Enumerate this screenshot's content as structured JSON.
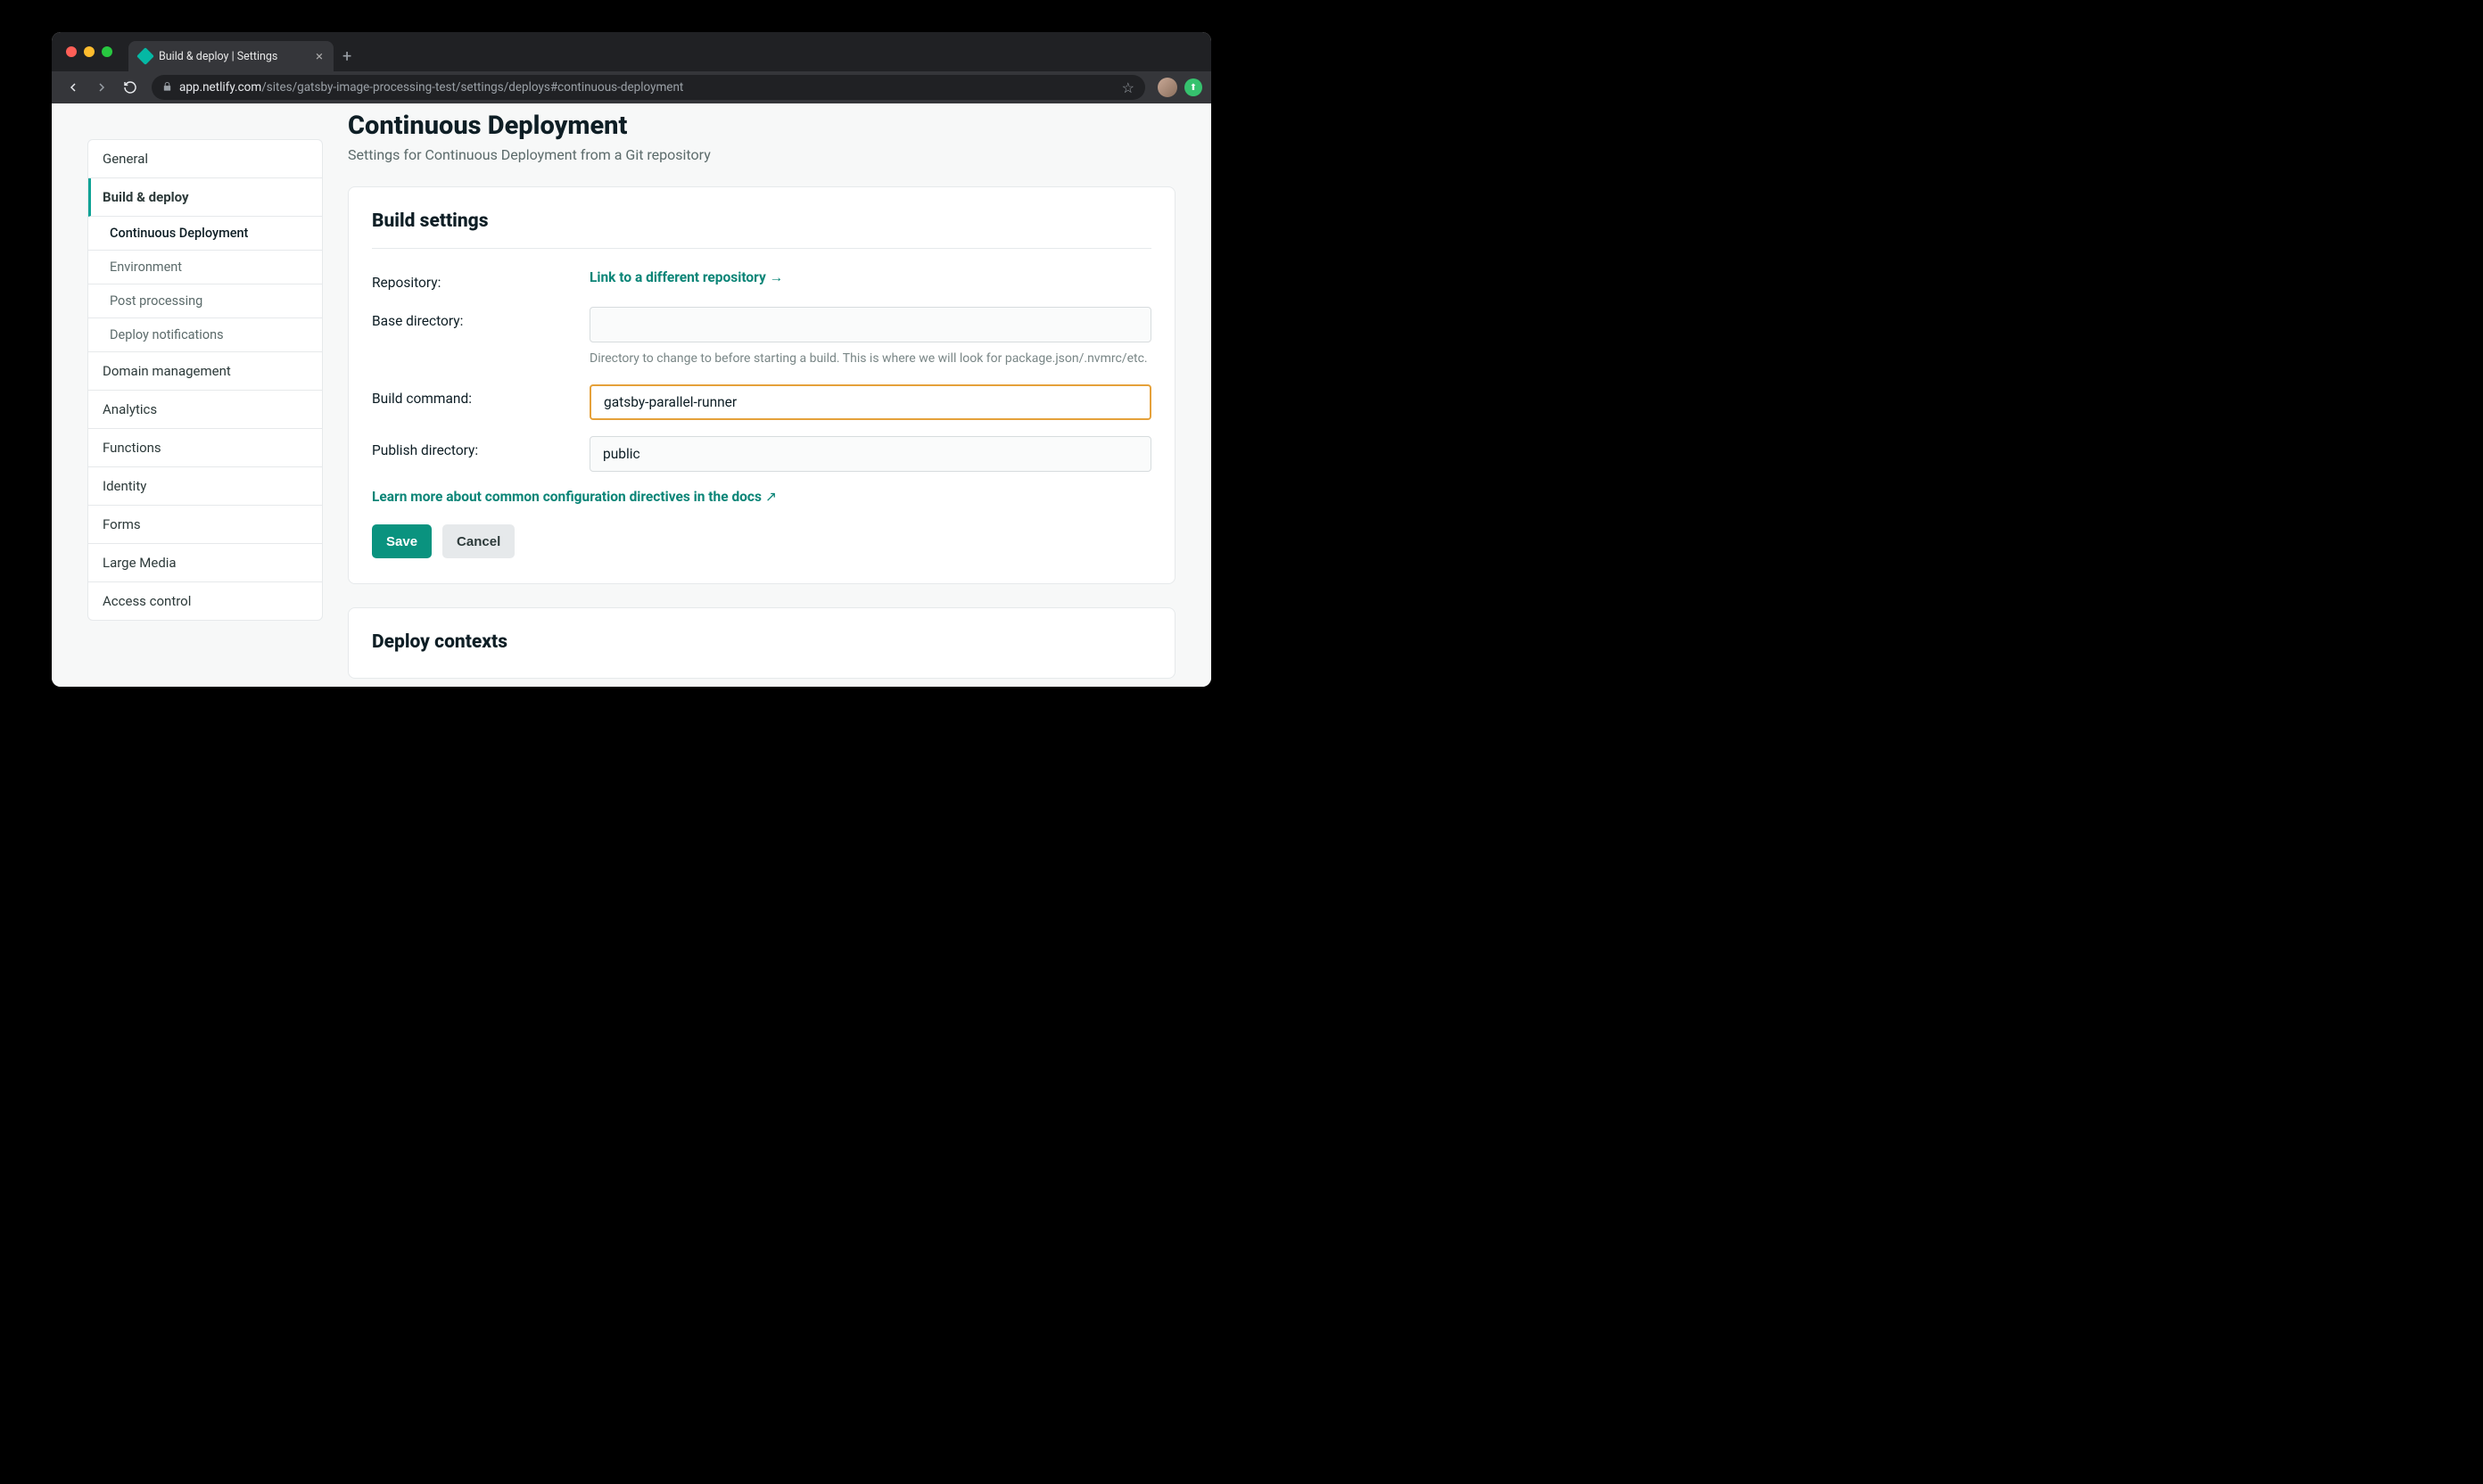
{
  "browser": {
    "tab_title": "Build & deploy | Settings",
    "url_host": "app.netlify.com",
    "url_path": "/sites/gatsby-image-processing-test/settings/deploys#continuous-deployment"
  },
  "sidebar": {
    "items": [
      {
        "label": "General"
      },
      {
        "label": "Build & deploy"
      },
      {
        "label": "Domain management"
      },
      {
        "label": "Analytics"
      },
      {
        "label": "Functions"
      },
      {
        "label": "Identity"
      },
      {
        "label": "Forms"
      },
      {
        "label": "Large Media"
      },
      {
        "label": "Access control"
      }
    ],
    "subs": [
      {
        "label": "Continuous Deployment"
      },
      {
        "label": "Environment"
      },
      {
        "label": "Post processing"
      },
      {
        "label": "Deploy notifications"
      }
    ]
  },
  "page": {
    "title": "Continuous Deployment",
    "subtitle": "Settings for Continuous Deployment from a Git repository"
  },
  "build_settings": {
    "heading": "Build settings",
    "repo_label": "Repository:",
    "repo_link": "Link to a different repository",
    "base_label": "Base directory:",
    "base_value": "",
    "base_help": "Directory to change to before starting a build. This is where we will look for package.json/.nvmrc/etc.",
    "cmd_label": "Build command:",
    "cmd_value": "gatsby-parallel-runner",
    "pub_label": "Publish directory:",
    "pub_value": "public",
    "learn_more": "Learn more about common configuration directives in the docs",
    "save": "Save",
    "cancel": "Cancel"
  },
  "deploy_contexts": {
    "heading": "Deploy contexts"
  }
}
